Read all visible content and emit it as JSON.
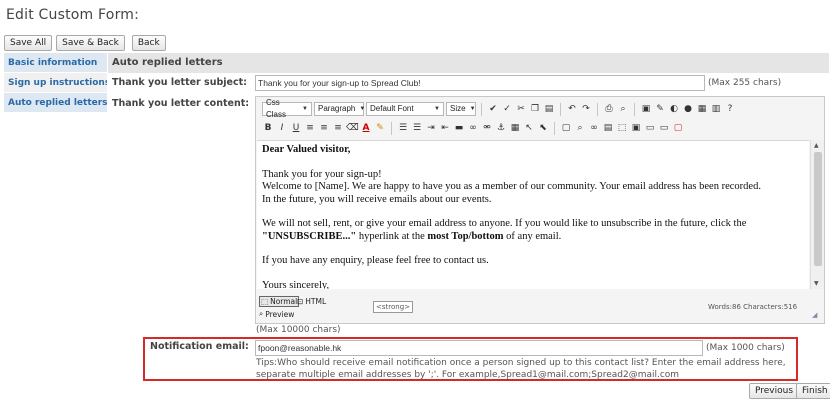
{
  "page_title": "Edit Custom Form:",
  "toolbar": {
    "save_all": "Save All",
    "save_back": "Save & Back",
    "back": "Back"
  },
  "tabs": [
    {
      "label": "Basic information"
    },
    {
      "label": "Sign up instructions"
    },
    {
      "label": "Auto replied letters"
    }
  ],
  "section_title": "Auto replied letters",
  "subject": {
    "label": "Thank you letter subject:",
    "value": "Thank you for your sign-up to Spread Club!",
    "limit": "(Max 255 chars)"
  },
  "content": {
    "label": "Thank you letter content:",
    "toolbar": {
      "css_class": "Css Class",
      "format": "Paragraph",
      "font": "Default Font",
      "size": "Size"
    },
    "body": {
      "greeting": "Dear Valued visitor,",
      "p1_l1": "Thank you for your sign-up!",
      "p1_l2": "Welcome to [Name]. We are happy to have you as a member of our community. Your email address has been recorded.",
      "p1_l3": "In the future, you will receive emails about our events.",
      "p2_a": "We will not sell, rent, or give your email address to anyone. If you would like to unsubscribe in the future, click the ",
      "p2_b": "\"UNSUBSCRIBE...\"",
      "p2_c": " hyperlink at the ",
      "p2_d": "most Top/bottom",
      "p2_e": " of any email.",
      "p3": "If you have any enquiry, please feel free to contact us.",
      "p4": "Yours sincerely,"
    },
    "modes": {
      "normal": "Normal",
      "html": "HTML",
      "preview": "Preview"
    },
    "tag_path": "<strong>",
    "stats": "Words:86 Characters:516",
    "limit": "(Max 10000 chars)"
  },
  "notification": {
    "label": "Notification email:",
    "value": "fpoon@reasonable.hk",
    "limit": "(Max 1000 chars)",
    "tip_l1": "Tips:Who should receive email notification once a person signed up to this contact list? Enter the email address here,",
    "tip_l2": "separate multiple email addresses by ';'. For example,Spread1@mail.com;Spread2@mail.com"
  },
  "nav": {
    "previous": "Previous",
    "finish": "Finish"
  }
}
